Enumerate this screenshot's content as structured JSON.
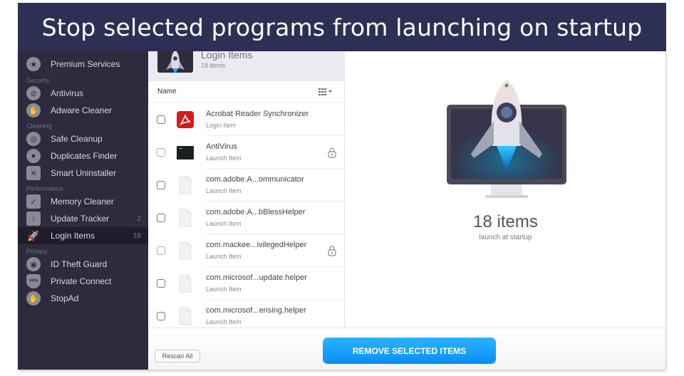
{
  "banner": {
    "title": "Stop selected programs from launching on startup"
  },
  "sidebar": {
    "items": [
      {
        "label": "Premium Services",
        "icon": "premium-icon",
        "badge": ""
      },
      {
        "section": "Security"
      },
      {
        "label": "Antivirus",
        "icon": "antivirus-icon",
        "badge": ""
      },
      {
        "label": "Adware Cleaner",
        "icon": "hand-icon",
        "badge": ""
      },
      {
        "section": "Cleaning"
      },
      {
        "label": "Safe Cleanup",
        "icon": "cleanup-icon",
        "badge": ""
      },
      {
        "label": "Duplicates Finder",
        "icon": "duplicates-icon",
        "badge": ""
      },
      {
        "label": "Smart Uninstaller",
        "icon": "uninstaller-icon",
        "badge": ""
      },
      {
        "section": "Performance"
      },
      {
        "label": "Memory Cleaner",
        "icon": "chip-icon",
        "badge": ""
      },
      {
        "label": "Update Tracker",
        "icon": "update-icon",
        "badge": "2"
      },
      {
        "label": "Login Items",
        "icon": "rocket-icon",
        "badge": "18",
        "active": true
      },
      {
        "section": "Privacy"
      },
      {
        "label": "ID Theft Guard",
        "icon": "fingerprint-icon",
        "badge": ""
      },
      {
        "label": "Private Connect",
        "icon": "vpn-shield-icon",
        "badge": ""
      },
      {
        "label": "StopAd",
        "icon": "stop-hand-icon",
        "badge": ""
      }
    ]
  },
  "list": {
    "header_title": "Login Items",
    "header_sub": "18 items",
    "column_name": "Name",
    "rows": [
      {
        "title": "Acrobat Reader Synchronizer",
        "sub": "Login Item",
        "icon": "acrobat-icon",
        "locked": false
      },
      {
        "title": "AntiVirus",
        "sub": "Launch Item",
        "icon": "terminal-icon",
        "locked": true
      },
      {
        "title": "com.adobe.A...ommunicator",
        "sub": "Launch Item",
        "icon": "file-icon",
        "locked": false
      },
      {
        "title": "com.adobe.A...bBlessHelper",
        "sub": "Launch Item",
        "icon": "file-icon",
        "locked": false
      },
      {
        "title": "com.mackee...ivilegedHelper",
        "sub": "Launch Item",
        "icon": "file-icon",
        "locked": true
      },
      {
        "title": "com.microsof...update.helper",
        "sub": "Launch Item",
        "icon": "file-icon",
        "locked": false
      },
      {
        "title": "com.microsof...ensing.helper",
        "sub": "Launch Item",
        "icon": "file-icon",
        "locked": false
      }
    ]
  },
  "summary": {
    "count": "18 items",
    "caption": "launch at startup"
  },
  "footer": {
    "rescan_label": "Rescan All",
    "remove_label": "REMOVE SELECTED ITEMS"
  },
  "colors": {
    "banner": "#2e2f55",
    "sidebar": "#2d2b3d",
    "accent": "#1a9cf7"
  }
}
